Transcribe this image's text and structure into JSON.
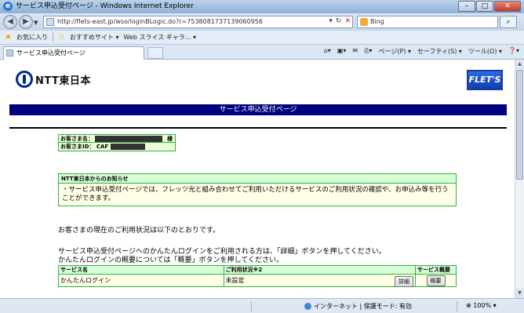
{
  "window": {
    "title": "サービス申込受付ページ - Windows Internet Explorer",
    "controls": {
      "minimize": "–",
      "maximize": "□",
      "close": "✕"
    }
  },
  "address_bar": {
    "url": "http://flets-east.jp/wso/loginBLogic.do?r=7538081737139060956",
    "search_engine": "Bing"
  },
  "favorites_bar": {
    "favorites_label": "お気に入り",
    "items": [
      "おすすめサイト ▾",
      "Web スライス ギャラ... ▾"
    ]
  },
  "tab": {
    "label": "サービス申込受付ページ"
  },
  "command_bar": {
    "items": [
      "ページ(P) ▾",
      "セーフティ(S) ▾",
      "ツール(O) ▾",
      "❓▾"
    ]
  },
  "page": {
    "logo_text": "NTT東日本",
    "flets_logo": "FLET'S",
    "heading": "サービス申込受付ページ",
    "customer": {
      "name_label": "お客さま名：",
      "name_suffix": "様",
      "id_label": "お客さまID：",
      "id_prefix": "CAF"
    },
    "notice": {
      "title": "NTT東日本からのお知らせ",
      "body": "・サービス申込受付ページでは、フレッツ光と組み合わせてご利用いただけるサービスのご利用状況の確認や、お申込み等を行うことができます。"
    },
    "status_intro": "お客さまの現在のご利用状況は以下のとおりです。",
    "info_line1": "サービス申込受付ページへのかんたんログインをご利用される方は、「詳細」ボタンを押してください。",
    "info_line2": "かんたんログインの概要については「概要」ボタンを押してください。",
    "table": {
      "headers": [
        "サービス名",
        "ご利用状況※2",
        "サービス概要"
      ],
      "rows": [
        {
          "service": "かんたんログイン",
          "status": "未設定",
          "detail_button": "詳細",
          "overview_button": "概要"
        }
      ]
    }
  },
  "status_bar": {
    "zone": "インターネット | 保護モード: 有効",
    "zoom": "100%"
  }
}
